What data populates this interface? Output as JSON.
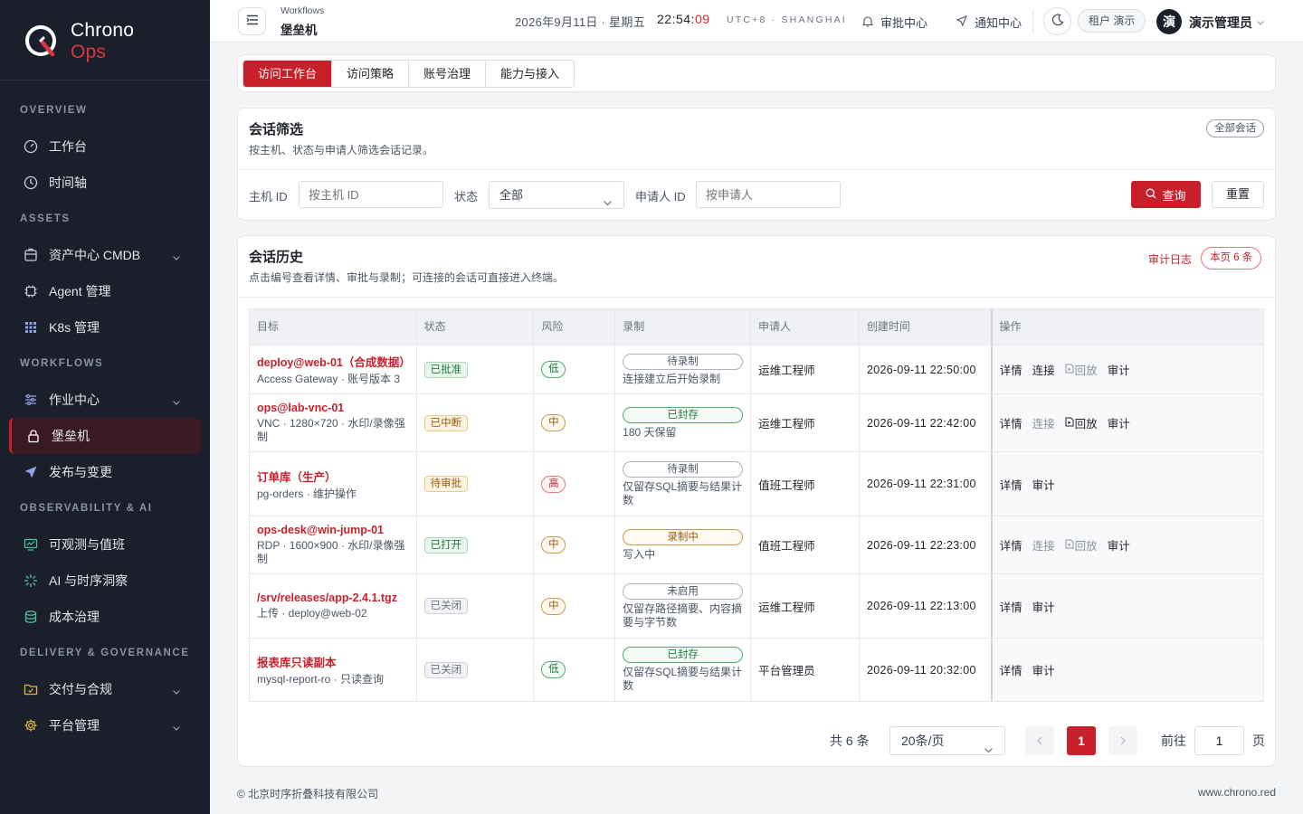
{
  "brand": {
    "name_main": "Chrono",
    "name_accent": "Ops"
  },
  "sidebar": {
    "sections": [
      {
        "title": "OVERVIEW",
        "items": [
          {
            "label": "工作台",
            "icon": "dashboard-icon"
          },
          {
            "label": "时间轴",
            "icon": "clock-icon"
          }
        ]
      },
      {
        "title": "ASSETS",
        "items": [
          {
            "label": "资产中心 CMDB",
            "icon": "database-box-icon",
            "expandable": true
          },
          {
            "label": "Agent 管理",
            "icon": "chip-icon"
          },
          {
            "label": "K8s 管理",
            "icon": "grid-icon"
          }
        ]
      },
      {
        "title": "WORKFLOWS",
        "items": [
          {
            "label": "作业中心",
            "icon": "sliders-icon",
            "expandable": true
          },
          {
            "label": "堡垒机",
            "icon": "lock-icon",
            "active": true
          },
          {
            "label": "发布与变更",
            "icon": "send-icon"
          }
        ]
      },
      {
        "title": "OBSERVABILITY & AI",
        "items": [
          {
            "label": "可观测与值班",
            "icon": "monitor-icon"
          },
          {
            "label": "AI 与时序洞察",
            "icon": "sparkle-icon"
          },
          {
            "label": "成本治理",
            "icon": "coins-icon"
          }
        ]
      },
      {
        "title": "DELIVERY & GOVERNANCE",
        "items": [
          {
            "label": "交付与合规",
            "icon": "folder-icon",
            "expandable": true
          },
          {
            "label": "平台管理",
            "icon": "gear-icon",
            "expandable": true
          }
        ]
      }
    ]
  },
  "header": {
    "breadcrumb_parent": "Workflows",
    "page_title": "堡垒机",
    "date": "2026年9月11日 · 星期五",
    "time_hm": "22:54:",
    "time_s": "09",
    "timezone": "UTC+8 · SHANGHAI",
    "approval_center": "审批中心",
    "notification_center": "通知中心",
    "tenant": "租户 演示",
    "avatar_text": "演",
    "user_name": "演示管理员"
  },
  "tabs": [
    "访问工作台",
    "访问策略",
    "账号治理",
    "能力与接入"
  ],
  "filter": {
    "title": "会话筛选",
    "desc": "按主机、状态与申请人筛选会话记录。",
    "scope_pill": "全部会话",
    "host_label": "主机 ID",
    "host_placeholder": "按主机 ID",
    "status_label": "状态",
    "status_value": "全部",
    "requester_label": "申请人 ID",
    "requester_placeholder": "按申请人",
    "query_button": "查询",
    "reset_button": "重置"
  },
  "history": {
    "title": "会话历史",
    "desc": "点击编号查看详情、审批与录制；可连接的会话可直接进入终端。",
    "audit_log": "审计日志",
    "page_count": "本页 6 条",
    "columns": [
      "目标",
      "状态",
      "风险",
      "录制",
      "申请人",
      "创建时间",
      "操作"
    ],
    "rows": [
      {
        "target": "deploy@web-01（合成数据）",
        "target_sub": "Access Gateway · 账号版本 3",
        "status": "已批准",
        "status_color": "green",
        "risk": "低",
        "risk_level": "low",
        "rec": "待录制",
        "rec_color": "gray",
        "rec_note": "连接建立后开始录制",
        "requester": "运维工程师",
        "created": "2026-09-11 22:50:00",
        "ops": [
          {
            "label": "详情",
            "dim": false
          },
          {
            "label": "连接",
            "dim": false
          },
          {
            "label": "回放",
            "dim": true,
            "icon": true
          },
          {
            "label": "审计",
            "dim": false
          }
        ]
      },
      {
        "target": "ops@lab-vnc-01",
        "target_sub": "VNC · 1280×720 · 水印/录像强制",
        "status": "已中断",
        "status_color": "amber",
        "risk": "中",
        "risk_level": "mid",
        "rec": "已封存",
        "rec_color": "green",
        "rec_note": "180 天保留",
        "requester": "运维工程师",
        "created": "2026-09-11 22:42:00",
        "ops": [
          {
            "label": "详情",
            "dim": false
          },
          {
            "label": "连接",
            "dim": true
          },
          {
            "label": "回放",
            "dim": false,
            "icon": true
          },
          {
            "label": "审计",
            "dim": false
          }
        ]
      },
      {
        "target": "订单库（生产）",
        "target_sub": "pg-orders · 维护操作",
        "status": "待审批",
        "status_color": "amber",
        "risk": "高",
        "risk_level": "high",
        "rec": "待录制",
        "rec_color": "gray",
        "rec_note": "仅留存SQL摘要与结果计数",
        "requester": "值班工程师",
        "created": "2026-09-11 22:31:00",
        "ops": [
          {
            "label": "详情",
            "dim": false
          },
          {
            "label": "审计",
            "dim": false
          }
        ]
      },
      {
        "target": "ops-desk@win-jump-01",
        "target_sub": "RDP · 1600×900 · 水印/录像强制",
        "status": "已打开",
        "status_color": "green",
        "risk": "中",
        "risk_level": "mid",
        "rec": "录制中",
        "rec_color": "amber",
        "rec_note": "写入中",
        "requester": "值班工程师",
        "created": "2026-09-11 22:23:00",
        "ops": [
          {
            "label": "详情",
            "dim": false
          },
          {
            "label": "连接",
            "dim": true
          },
          {
            "label": "回放",
            "dim": true,
            "icon": true
          },
          {
            "label": "审计",
            "dim": false
          }
        ]
      },
      {
        "target": "/srv/releases/app-2.4.1.tgz",
        "target_sub": "上传 · deploy@web-02",
        "status": "已关闭",
        "status_color": "gray",
        "risk": "中",
        "risk_level": "mid",
        "rec": "未启用",
        "rec_color": "gray",
        "rec_note": "仅留存路径摘要、内容摘要与字节数",
        "requester": "运维工程师",
        "created": "2026-09-11 22:13:00",
        "ops": [
          {
            "label": "详情",
            "dim": false
          },
          {
            "label": "审计",
            "dim": false
          }
        ]
      },
      {
        "target": "报表库只读副本",
        "target_sub": "mysql-report-ro · 只读查询",
        "status": "已关闭",
        "status_color": "gray",
        "risk": "低",
        "risk_level": "low",
        "rec": "已封存",
        "rec_color": "green",
        "rec_note": "仅留存SQL摘要与结果计数",
        "requester": "平台管理员",
        "created": "2026-09-11 20:32:00",
        "ops": [
          {
            "label": "详情",
            "dim": false
          },
          {
            "label": "审计",
            "dim": false
          }
        ]
      }
    ]
  },
  "pagination": {
    "total": "共 6 条",
    "page_size": "20条/页",
    "current": "1",
    "goto_label": "前往",
    "goto_value": "1",
    "goto_unit": "页"
  },
  "footer": {
    "copyright": "© 北京时序折叠科技有限公司",
    "site": "www.chrono.red"
  },
  "colors": {
    "accent": "#c8202b",
    "sidebar_bg": "#1a1f2b"
  }
}
